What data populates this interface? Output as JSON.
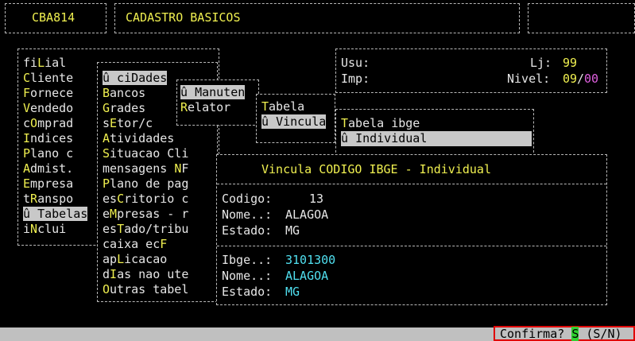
{
  "header": {
    "code": "CBA814",
    "title": "CADASTRO BASICOS"
  },
  "info": {
    "usu_label": "Usu:",
    "imp_label": "Imp:",
    "lj_label": "Lj:",
    "lj_value": "99",
    "nivel_label": "Nivel:",
    "nivel_value1": "09",
    "nivel_sep": "/",
    "nivel_value2": "00"
  },
  "main_menu": [
    {
      "hot": "",
      "pre": "fi",
      "key": "L",
      "post": "ial",
      "selected": false
    },
    {
      "pre": "",
      "key": "C",
      "post": "liente",
      "selected": false
    },
    {
      "pre": "",
      "key": "F",
      "post": "ornece",
      "selected": false
    },
    {
      "pre": "",
      "key": "V",
      "post": "endedo",
      "selected": false
    },
    {
      "pre": "c",
      "key": "O",
      "post": "mprad",
      "selected": false
    },
    {
      "pre": "",
      "key": "I",
      "post": "ndices",
      "selected": false
    },
    {
      "pre": "",
      "key": "P",
      "post": "lano c",
      "selected": false
    },
    {
      "pre": "",
      "key": "A",
      "post": "dmist.",
      "selected": false
    },
    {
      "pre": "",
      "key": "E",
      "post": "mpresa",
      "selected": false
    },
    {
      "pre": "t",
      "key": "R",
      "post": "anspo",
      "selected": false
    },
    {
      "pre": "û ",
      "key": "T",
      "post": "abelas",
      "selected": true
    },
    {
      "pre": "i",
      "key": "N",
      "post": "clui",
      "selected": false
    }
  ],
  "tabelas_menu": [
    {
      "pre": "û ci",
      "key": "D",
      "post": "ades",
      "selected": true
    },
    {
      "pre": "",
      "key": "B",
      "post": "ancos",
      "selected": false
    },
    {
      "pre": "",
      "key": "G",
      "post": "rades",
      "selected": false
    },
    {
      "pre": "s",
      "key": "E",
      "post": "tor/c",
      "selected": false
    },
    {
      "pre": "",
      "key": "A",
      "post": "tividades",
      "selected": false
    },
    {
      "pre": "",
      "key": "S",
      "post": "ituacao Cli",
      "selected": false
    },
    {
      "pre": "mensagens ",
      "key": "N",
      "post": "F",
      "selected": false
    },
    {
      "pre": "",
      "key": "P",
      "post": "lano de pag",
      "selected": false
    },
    {
      "pre": "es",
      "key": "C",
      "post": "ritorio c",
      "selected": false
    },
    {
      "pre": "e",
      "key": "M",
      "post": "presas - r",
      "selected": false
    },
    {
      "pre": "es",
      "key": "T",
      "post": "ado/tribu",
      "selected": false
    },
    {
      "pre": "caixa ec",
      "key": "F",
      "post": "",
      "selected": false
    },
    {
      "pre": "ap",
      "key": "L",
      "post": "icacao",
      "selected": false
    },
    {
      "pre": "d",
      "key": "I",
      "post": "as nao ute",
      "selected": false
    },
    {
      "pre": "",
      "key": "O",
      "post": "utras tabel",
      "selected": false
    }
  ],
  "cidades_menu": [
    {
      "pre": "û ",
      "key": "M",
      "post": "anuten",
      "selected": true
    },
    {
      "pre": "",
      "key": "R",
      "post": "elator",
      "selected": false
    }
  ],
  "manut_menu": [
    {
      "pre": "",
      "key": "T",
      "post": "abela",
      "selected": false
    },
    {
      "pre": "û ",
      "key": "V",
      "post": "incula",
      "selected": true
    }
  ],
  "vincula_menu": [
    {
      "pre": "",
      "key": "T",
      "post": "abela ibge",
      "selected": false
    },
    {
      "pre": "û ",
      "key": "I",
      "post": "ndividual",
      "selected": true
    }
  ],
  "dialog": {
    "title": "Vincula CODIGO IBGE - Individual",
    "codigo_label": "Codigo:",
    "codigo_value": "13",
    "nome_label": "Nome..:",
    "nome_value": "ALAGOA",
    "estado_label": "Estado:",
    "estado_value": "MG",
    "ibge_label": "Ibge..:",
    "ibge_value": "3101300",
    "nome2_label": "Nome..:",
    "nome2_value": "ALAGOA",
    "estado2_label": "Estado:",
    "estado2_value": "MG"
  },
  "status": {
    "confirm_label": "Confirma? ",
    "confirm_value": "S",
    "confirm_options": " (S/N)"
  }
}
